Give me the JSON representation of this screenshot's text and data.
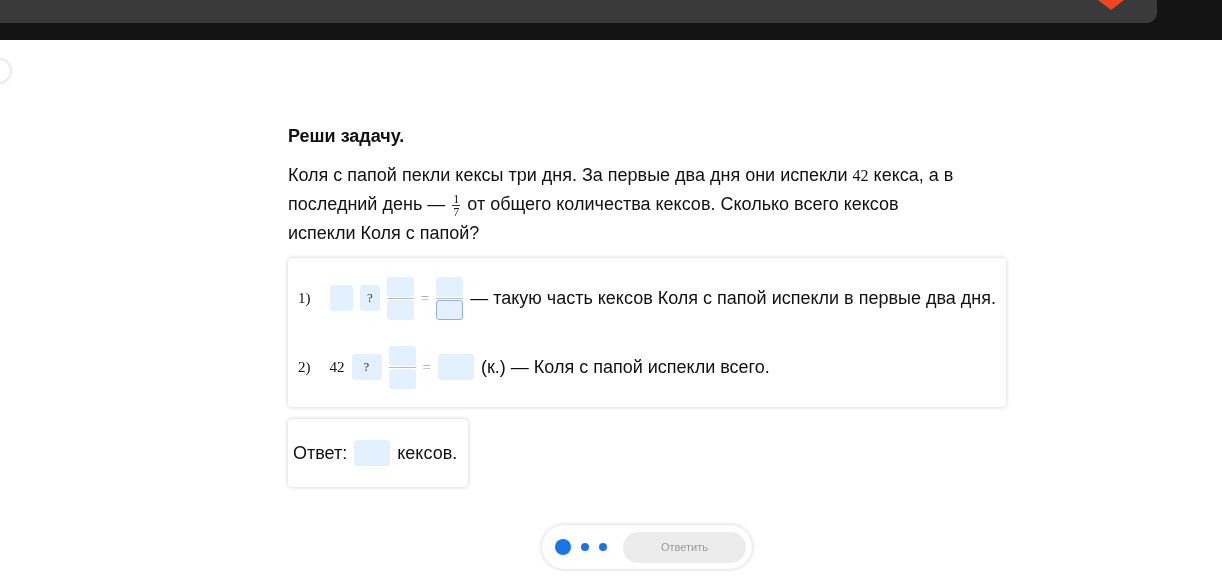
{
  "title": "Реши задачу.",
  "problem": [
    {
      "kind": "text",
      "text": "Коля с папой пекли кексы три дня. За первые два дня они испекли "
    },
    {
      "kind": "math",
      "text": "42"
    },
    {
      "kind": "text",
      "text": " кекса, а в последний день — "
    },
    {
      "kind": "fraction",
      "numerator": "1",
      "denominator": "7"
    },
    {
      "kind": "text",
      "text": " от общего количества кексов. Сколько всего кексов испекли Коля с папой?"
    }
  ],
  "steps": [
    {
      "items": [
        {
          "kind": "label",
          "text": "1)"
        },
        {
          "kind": "box",
          "focused": false
        },
        {
          "kind": "choice",
          "text": "?"
        },
        {
          "kind": "fraction",
          "numerator": {
            "focused": false
          },
          "denominator": {
            "focused": false
          }
        },
        {
          "kind": "equals",
          "text": "="
        },
        {
          "kind": "fraction",
          "numerator": {
            "focused": false
          },
          "denominator": {
            "focused": true
          }
        },
        {
          "kind": "text",
          "text": "— такую часть кексов Коля с папой испекли в первые два дня."
        }
      ]
    },
    {
      "items": [
        {
          "kind": "label",
          "text": "2)"
        },
        {
          "kind": "math",
          "text": "42"
        },
        {
          "kind": "choice",
          "text": "?"
        },
        {
          "kind": "fraction",
          "numerator": {
            "focused": false
          },
          "denominator": {
            "focused": false
          }
        },
        {
          "kind": "equals",
          "text": "="
        },
        {
          "kind": "box",
          "focused": false
        },
        {
          "kind": "text",
          "text": "(к.) — Коля с папой испекли всего."
        }
      ]
    }
  ],
  "answer": {
    "label": "Ответ:",
    "field": {
      "focused": false
    },
    "unit": "кексов."
  },
  "pager": [
    {
      "selected": true
    },
    {
      "selected": false
    },
    {
      "selected": false
    }
  ],
  "submit": {
    "label": "Ответить",
    "disabled": true
  }
}
